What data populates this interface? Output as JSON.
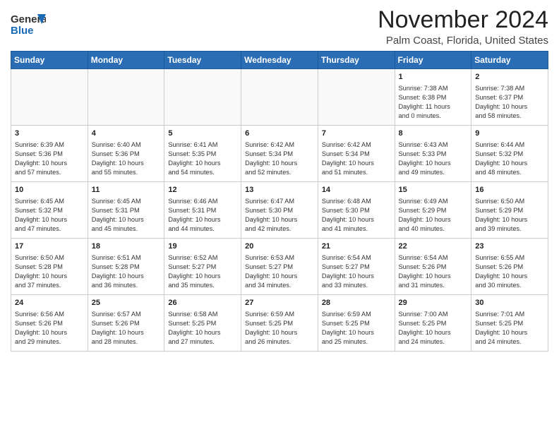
{
  "header": {
    "logo_line1": "General",
    "logo_line2": "Blue",
    "title": "November 2024",
    "subtitle": "Palm Coast, Florida, United States"
  },
  "weekdays": [
    "Sunday",
    "Monday",
    "Tuesday",
    "Wednesday",
    "Thursday",
    "Friday",
    "Saturday"
  ],
  "weeks": [
    [
      {
        "day": "",
        "info": ""
      },
      {
        "day": "",
        "info": ""
      },
      {
        "day": "",
        "info": ""
      },
      {
        "day": "",
        "info": ""
      },
      {
        "day": "",
        "info": ""
      },
      {
        "day": "1",
        "info": "Sunrise: 7:38 AM\nSunset: 6:38 PM\nDaylight: 11 hours\nand 0 minutes."
      },
      {
        "day": "2",
        "info": "Sunrise: 7:38 AM\nSunset: 6:37 PM\nDaylight: 10 hours\nand 58 minutes."
      }
    ],
    [
      {
        "day": "3",
        "info": "Sunrise: 6:39 AM\nSunset: 5:36 PM\nDaylight: 10 hours\nand 57 minutes."
      },
      {
        "day": "4",
        "info": "Sunrise: 6:40 AM\nSunset: 5:36 PM\nDaylight: 10 hours\nand 55 minutes."
      },
      {
        "day": "5",
        "info": "Sunrise: 6:41 AM\nSunset: 5:35 PM\nDaylight: 10 hours\nand 54 minutes."
      },
      {
        "day": "6",
        "info": "Sunrise: 6:42 AM\nSunset: 5:34 PM\nDaylight: 10 hours\nand 52 minutes."
      },
      {
        "day": "7",
        "info": "Sunrise: 6:42 AM\nSunset: 5:34 PM\nDaylight: 10 hours\nand 51 minutes."
      },
      {
        "day": "8",
        "info": "Sunrise: 6:43 AM\nSunset: 5:33 PM\nDaylight: 10 hours\nand 49 minutes."
      },
      {
        "day": "9",
        "info": "Sunrise: 6:44 AM\nSunset: 5:32 PM\nDaylight: 10 hours\nand 48 minutes."
      }
    ],
    [
      {
        "day": "10",
        "info": "Sunrise: 6:45 AM\nSunset: 5:32 PM\nDaylight: 10 hours\nand 47 minutes."
      },
      {
        "day": "11",
        "info": "Sunrise: 6:45 AM\nSunset: 5:31 PM\nDaylight: 10 hours\nand 45 minutes."
      },
      {
        "day": "12",
        "info": "Sunrise: 6:46 AM\nSunset: 5:31 PM\nDaylight: 10 hours\nand 44 minutes."
      },
      {
        "day": "13",
        "info": "Sunrise: 6:47 AM\nSunset: 5:30 PM\nDaylight: 10 hours\nand 42 minutes."
      },
      {
        "day": "14",
        "info": "Sunrise: 6:48 AM\nSunset: 5:30 PM\nDaylight: 10 hours\nand 41 minutes."
      },
      {
        "day": "15",
        "info": "Sunrise: 6:49 AM\nSunset: 5:29 PM\nDaylight: 10 hours\nand 40 minutes."
      },
      {
        "day": "16",
        "info": "Sunrise: 6:50 AM\nSunset: 5:29 PM\nDaylight: 10 hours\nand 39 minutes."
      }
    ],
    [
      {
        "day": "17",
        "info": "Sunrise: 6:50 AM\nSunset: 5:28 PM\nDaylight: 10 hours\nand 37 minutes."
      },
      {
        "day": "18",
        "info": "Sunrise: 6:51 AM\nSunset: 5:28 PM\nDaylight: 10 hours\nand 36 minutes."
      },
      {
        "day": "19",
        "info": "Sunrise: 6:52 AM\nSunset: 5:27 PM\nDaylight: 10 hours\nand 35 minutes."
      },
      {
        "day": "20",
        "info": "Sunrise: 6:53 AM\nSunset: 5:27 PM\nDaylight: 10 hours\nand 34 minutes."
      },
      {
        "day": "21",
        "info": "Sunrise: 6:54 AM\nSunset: 5:27 PM\nDaylight: 10 hours\nand 33 minutes."
      },
      {
        "day": "22",
        "info": "Sunrise: 6:54 AM\nSunset: 5:26 PM\nDaylight: 10 hours\nand 31 minutes."
      },
      {
        "day": "23",
        "info": "Sunrise: 6:55 AM\nSunset: 5:26 PM\nDaylight: 10 hours\nand 30 minutes."
      }
    ],
    [
      {
        "day": "24",
        "info": "Sunrise: 6:56 AM\nSunset: 5:26 PM\nDaylight: 10 hours\nand 29 minutes."
      },
      {
        "day": "25",
        "info": "Sunrise: 6:57 AM\nSunset: 5:26 PM\nDaylight: 10 hours\nand 28 minutes."
      },
      {
        "day": "26",
        "info": "Sunrise: 6:58 AM\nSunset: 5:25 PM\nDaylight: 10 hours\nand 27 minutes."
      },
      {
        "day": "27",
        "info": "Sunrise: 6:59 AM\nSunset: 5:25 PM\nDaylight: 10 hours\nand 26 minutes."
      },
      {
        "day": "28",
        "info": "Sunrise: 6:59 AM\nSunset: 5:25 PM\nDaylight: 10 hours\nand 25 minutes."
      },
      {
        "day": "29",
        "info": "Sunrise: 7:00 AM\nSunset: 5:25 PM\nDaylight: 10 hours\nand 24 minutes."
      },
      {
        "day": "30",
        "info": "Sunrise: 7:01 AM\nSunset: 5:25 PM\nDaylight: 10 hours\nand 24 minutes."
      }
    ]
  ]
}
